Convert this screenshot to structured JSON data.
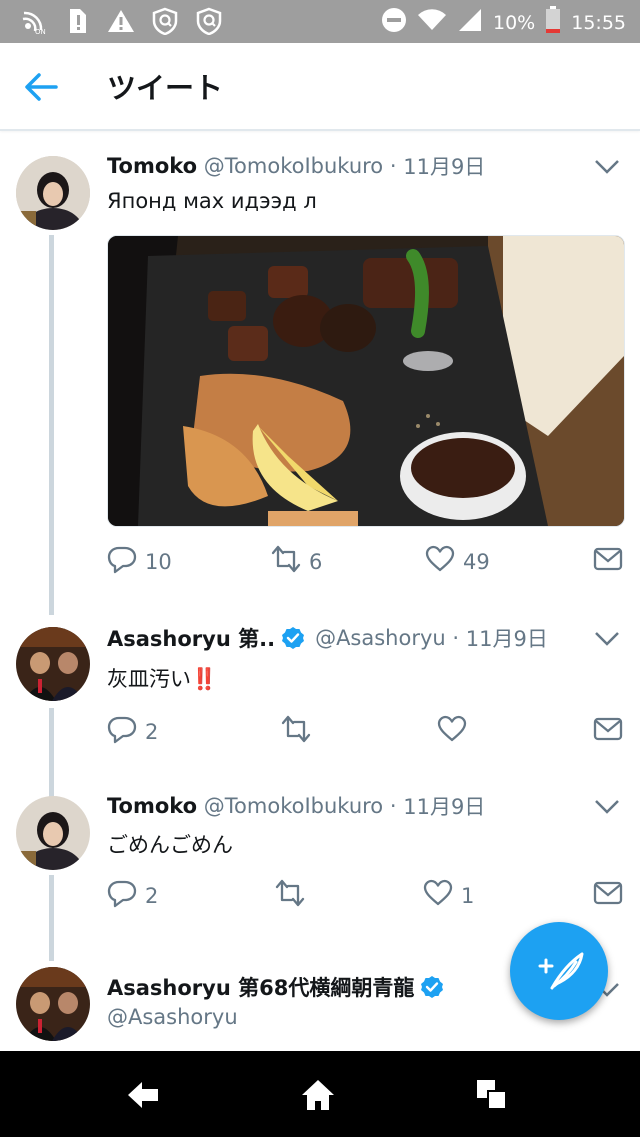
{
  "status_bar": {
    "battery": "10%",
    "time": "15:55"
  },
  "app_bar": {
    "title": "ツイート"
  },
  "tweets": [
    {
      "name": "Tomoko",
      "handle": "@TomokoIbukuro",
      "date": "11月9日",
      "text": "Японд мах идээд л",
      "replies": "10",
      "retweets": "6",
      "likes": "49",
      "has_media": true
    },
    {
      "name": "Asashoryu 第..",
      "handle": "@Asashoryu",
      "date": "11月9日",
      "text": "灰皿汚い",
      "emoji": "‼️",
      "replies": "2",
      "retweets": "",
      "likes": "",
      "verified": true
    },
    {
      "name": "Tomoko",
      "handle": "@TomokoIbukuro",
      "date": "11月9日",
      "text": "ごめんごめん",
      "replies": "2",
      "retweets": "",
      "likes": "1"
    },
    {
      "name": "Asashoryu 第68代横綱朝青龍",
      "handle": "@Asashoryu",
      "verified": true
    }
  ],
  "separator": "·",
  "colors": {
    "accent": "#1da1f2",
    "secondary_text": "#657786",
    "thread_line": "#ccd6dd",
    "exclaim": "#e0245e"
  }
}
